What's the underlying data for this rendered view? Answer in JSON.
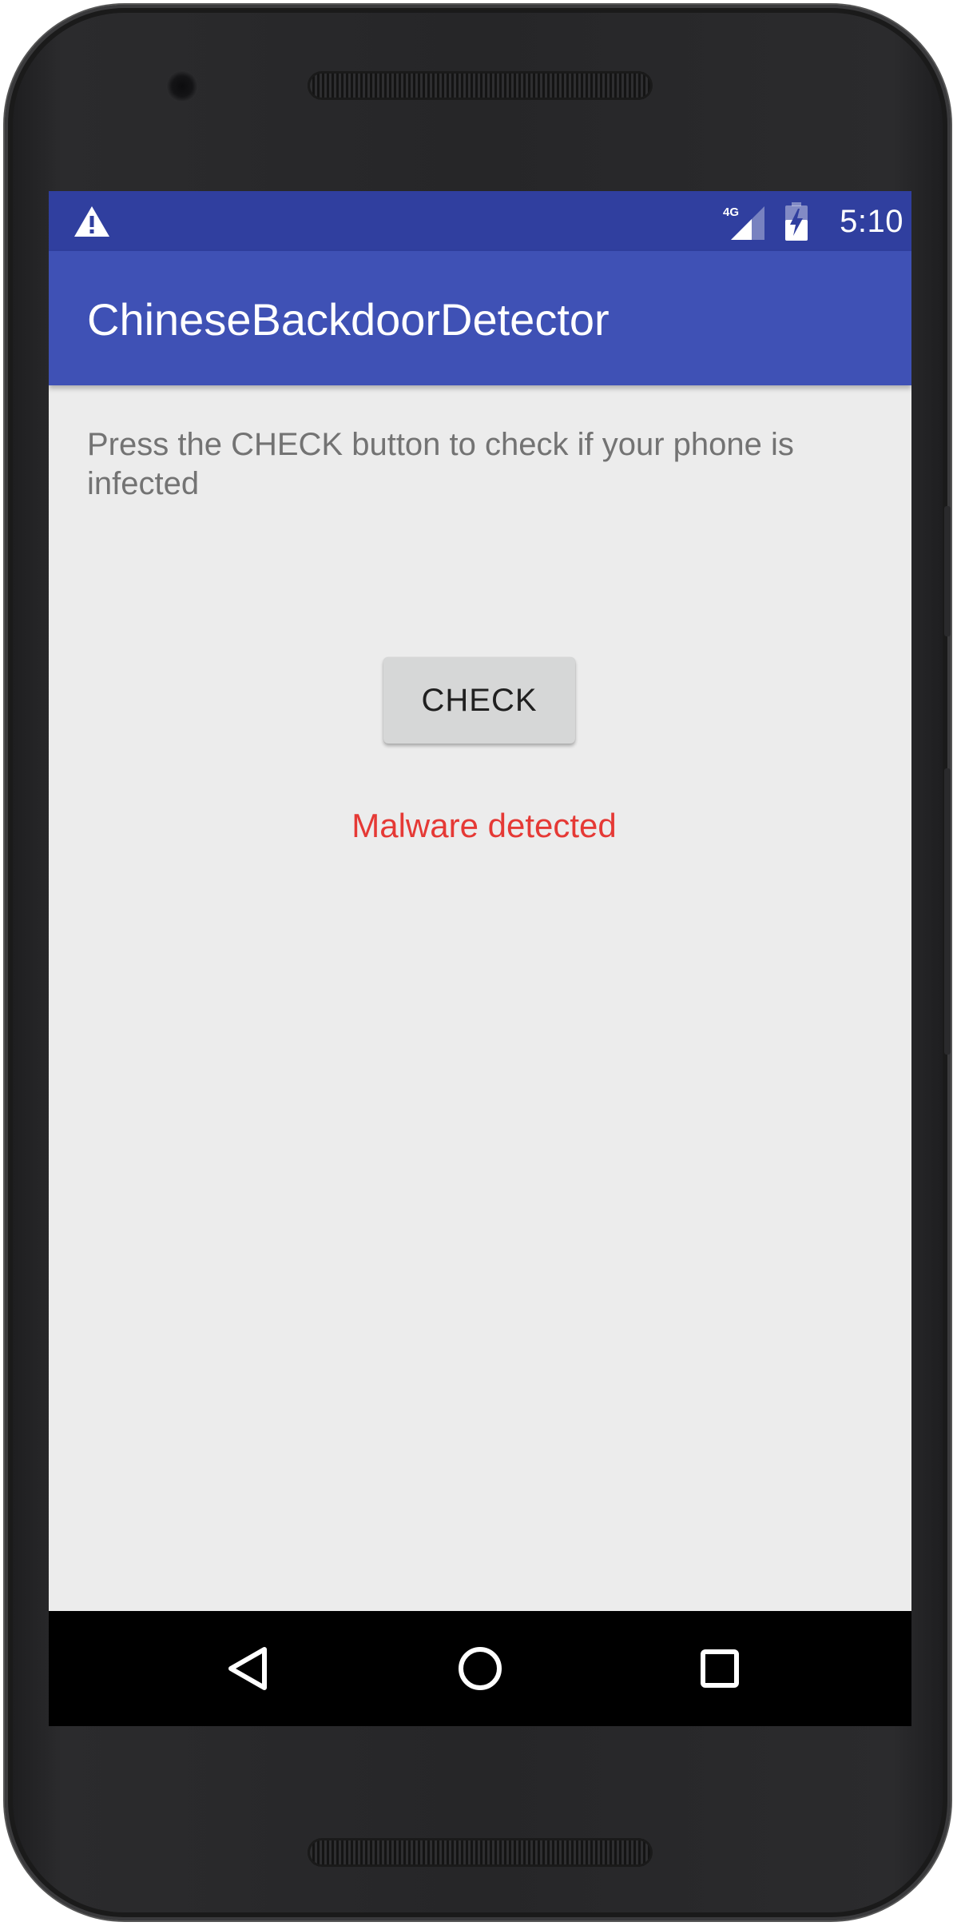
{
  "status_bar": {
    "time": "5:10",
    "network_label": "4G",
    "icons": [
      "warning-icon",
      "signal-4g-icon",
      "battery-charging-icon"
    ]
  },
  "app_bar": {
    "title": "ChineseBackdoorDetector"
  },
  "main": {
    "instructions": "Press the CHECK button to check if your phone is infected",
    "check_button_label": "CHECK",
    "result_text": "Malware detected"
  },
  "nav_bar": {
    "icons": [
      "back-icon",
      "home-icon",
      "recents-icon"
    ]
  },
  "colors": {
    "status_bar": "#303f9f",
    "app_bar": "#3f51b5",
    "background": "#ececec",
    "result": "#e53935",
    "button": "#d6d7d7"
  }
}
